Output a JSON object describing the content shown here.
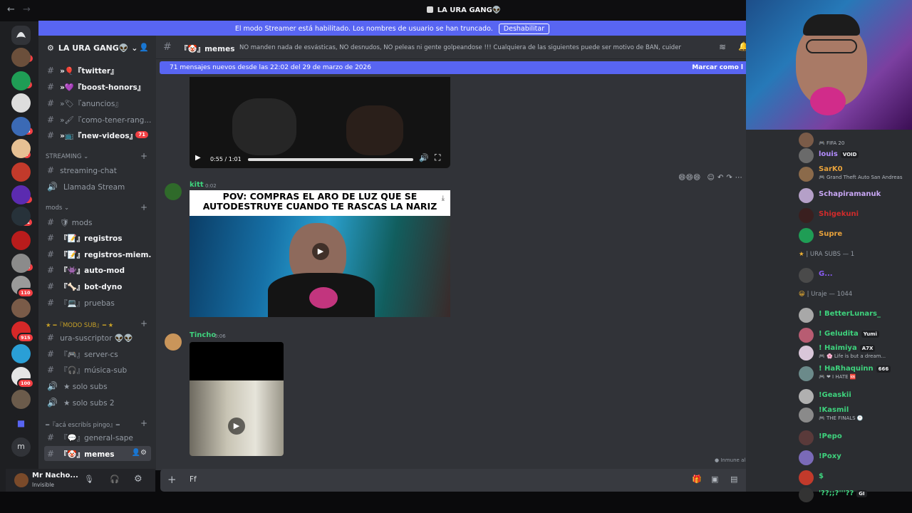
{
  "window": {
    "title": "LA URA GANG👽"
  },
  "streamer_banner": {
    "text": "El modo Streamer está habilitado. Los nombres de usuario se han truncado.",
    "button": "Deshabilitar"
  },
  "server_badges": [
    "158",
    "24",
    "116",
    "1",
    "17",
    "11",
    "153",
    "110",
    "915",
    "100"
  ],
  "guild": {
    "name": "LA URA GANG👽"
  },
  "channels": [
    {
      "label": "»🎈『twitter』",
      "bright": true
    },
    {
      "label": "»💜『boost-honors』",
      "bright": true
    },
    {
      "label": "»🏷『anuncios』",
      "bright": false
    },
    {
      "label": "»🖌『como-tener-rang...",
      "bright": false
    },
    {
      "label": "»📺『new-videos』",
      "bright": true,
      "badge": "71"
    }
  ],
  "cat_streaming": "STREAMING",
  "streaming_channels": [
    {
      "label": "streaming-chat",
      "type": "text"
    },
    {
      "label": "Llamada Stream",
      "type": "voice"
    }
  ],
  "cat_mods": "mods",
  "mods_channels": [
    {
      "label": "🛡 mods",
      "bright": false
    },
    {
      "label": "『📝』registros",
      "bright": true
    },
    {
      "label": "『📝』registros-miem...",
      "bright": true
    },
    {
      "label": "『👾』auto-mod",
      "bright": true
    },
    {
      "label": "『🦴』bot-dyno",
      "bright": true
    },
    {
      "label": "『💻』pruebas",
      "bright": false
    }
  ],
  "cat_modo_sub": "★ ━『MODO SUB』━ ★",
  "sub_channels": [
    {
      "label": "ura-suscriptor 👽👽",
      "type": "text"
    },
    {
      "label": "『🎮』server-cs",
      "type": "text"
    },
    {
      "label": "『🎧』música-sub",
      "type": "text"
    },
    {
      "label": "★ solo subs",
      "type": "voice"
    },
    {
      "label": "★ solo subs 2",
      "type": "voice"
    }
  ],
  "cat_aca": "━『acá escribís pingo』━",
  "aca_channels": [
    {
      "label": "『💬』general-sape",
      "bright": false
    },
    {
      "label": "『🤡』memes",
      "bright": true,
      "selected": true
    }
  ],
  "user": {
    "name": "Mr Nacho...",
    "status": "Invisible"
  },
  "chat_header": {
    "channel": "『🤡』memes",
    "topic": "NO manden nada de esvásticas, NO desnudos, NO peleas ni gente golpeandose !!! Cualquiera de las siguientes puede ser motivo de BAN, cuiden el stream!"
  },
  "new_messages": {
    "text": "71 mensajes nuevos desde las 22:02 del 29 de marzo de 2026",
    "action": "Marcar como l"
  },
  "video1": {
    "time": "0:55 / 1:01"
  },
  "messages": [
    {
      "author": "kitt",
      "time": "0:02",
      "caption_line1": "POV: COMPRAS EL ARO DE LUZ QUE SE",
      "caption_line2": "AUTODESTRUYE CUANDO TE RASCAS LA NARIZ"
    },
    {
      "author": "Tincho",
      "time": "0:06"
    }
  ],
  "immune_text": "Inmune al modo pausado",
  "input": {
    "value": "Ff"
  },
  "members_groups": [
    {
      "name": "| URA SUBS — 1",
      "prefix": "★"
    },
    {
      "name": "| Uraje — 1044",
      "prefix": "😀"
    }
  ],
  "members_top": [
    {
      "name": "",
      "sub": "🎮 FIFA 20",
      "color": "#b5bac1"
    },
    {
      "name": "louis",
      "sub": "",
      "tag": "VOID",
      "color": "#b38cff"
    },
    {
      "name": "SarK0",
      "sub": "🎮 Grand Theft Auto San Andreas",
      "color": "#e8a23b"
    },
    {
      "name": "Schapiramanuk",
      "sub": "",
      "color": "#c9a7f5"
    },
    {
      "name": "Shigekuni",
      "sub": "",
      "color": "#d02b2b"
    },
    {
      "name": "Supre",
      "sub": "",
      "color": "#e8a23b"
    }
  ],
  "members_sub": [
    {
      "name": "G...",
      "sub": "",
      "color": "#8b5cf6"
    }
  ],
  "members_uraje": [
    {
      "name": "! BetterLunars_",
      "sub": "",
      "color": "#3ed37d"
    },
    {
      "name": "! Geludita",
      "sub": "",
      "tag": "Yumi",
      "color": "#3ed37d"
    },
    {
      "name": "! Haimiya",
      "sub": "🎮 🌸 Life is but a dream...",
      "tag": "A7X",
      "color": "#3ed37d"
    },
    {
      "name": "! HaRhaquinn",
      "sub": "🎮 ❤ I HATE 🆘",
      "tag": "666",
      "color": "#3ed37d"
    },
    {
      "name": "!Geaskii",
      "sub": "",
      "color": "#3ed37d"
    },
    {
      "name": "!Kasmil",
      "sub": "🎮 THE FINALS 🕐",
      "color": "#3ed37d"
    },
    {
      "name": "!Pepo",
      "sub": "",
      "color": "#3ed37d"
    },
    {
      "name": "!Poxy",
      "sub": "",
      "color": "#3ed37d"
    },
    {
      "name": "$",
      "sub": "",
      "color": "#3ed37d"
    },
    {
      "name": "'??;;?'''??",
      "sub": "",
      "tag": "GI",
      "color": "#3ed37d"
    }
  ]
}
